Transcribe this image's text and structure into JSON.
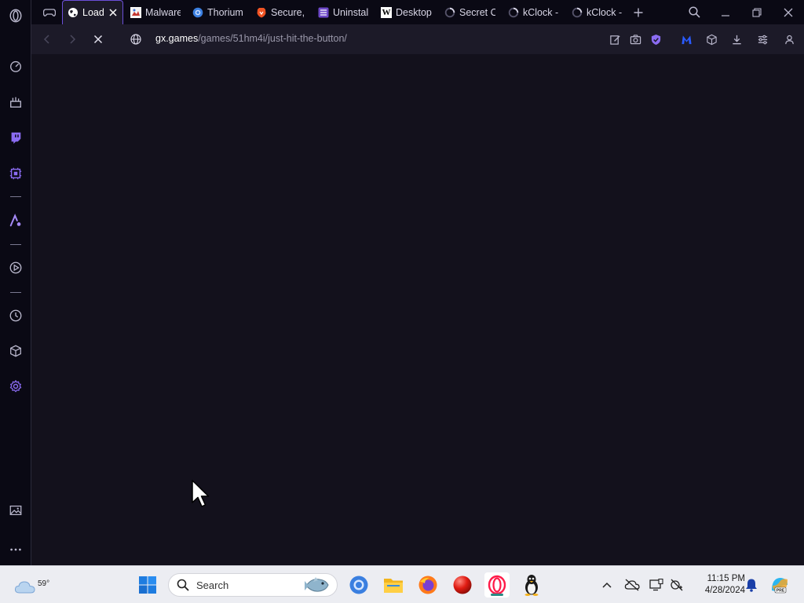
{
  "browser": {
    "tabs": [
      {
        "title": "Load",
        "favicon": "globe-icon"
      },
      {
        "title": "Malware",
        "favicon": "malware-site-icon"
      },
      {
        "title": "Thorium",
        "favicon": "thorium-icon"
      },
      {
        "title": "Secure, I",
        "favicon": "brave-lion-icon"
      },
      {
        "title": "Uninstall",
        "favicon": "list-icon"
      },
      {
        "title": "Desktop",
        "favicon": "w-letter-icon"
      },
      {
        "title": "Secret C",
        "favicon": "loading-spinner-icon"
      },
      {
        "title": "kClock -",
        "favicon": "loading-spinner-icon"
      },
      {
        "title": "kClock -",
        "favicon": "loading-spinner-icon"
      }
    ],
    "address": {
      "host": "gx.games",
      "path": "/games/51hm4i/just-hit-the-button/"
    },
    "accent_color": "#6b4fd8"
  },
  "taskbar": {
    "weather_temp": "59°",
    "search_placeholder": "Search",
    "clock_time": "11:15 PM",
    "clock_date": "4/28/2024"
  }
}
